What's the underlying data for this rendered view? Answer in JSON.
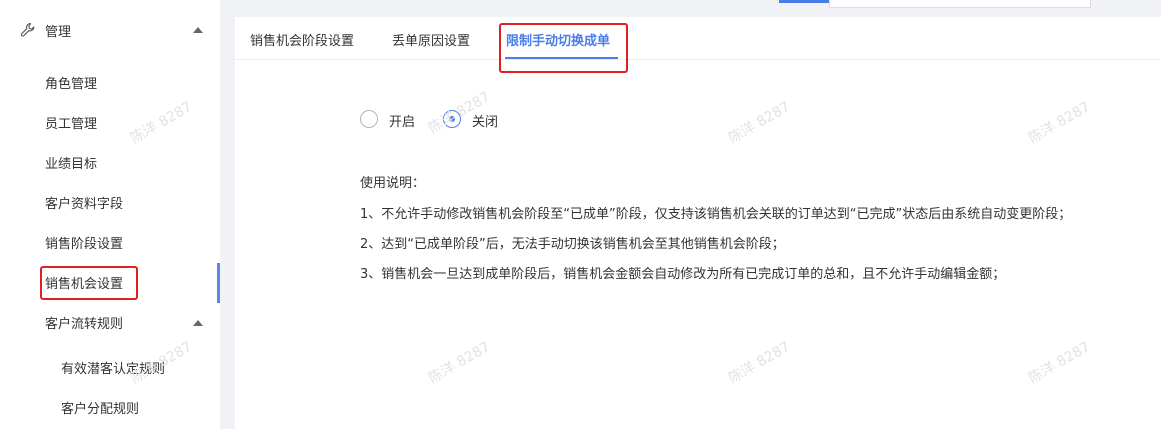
{
  "sidebar": {
    "section": {
      "label": "管理",
      "icon": "wrench-icon",
      "expanded": true
    },
    "items": [
      {
        "label": "角色管理"
      },
      {
        "label": "员工管理"
      },
      {
        "label": "业绩目标"
      },
      {
        "label": "客户资料字段"
      },
      {
        "label": "销售阶段设置"
      },
      {
        "label": "销售机会设置",
        "active": true,
        "highlighted": true
      }
    ],
    "subsection": {
      "label": "客户流转规则",
      "expanded": true,
      "children": [
        {
          "label": "有效潜客认定规则"
        },
        {
          "label": "客户分配规则"
        }
      ]
    }
  },
  "tabs": [
    {
      "label": "销售机会阶段设置"
    },
    {
      "label": "丢单原因设置"
    },
    {
      "label": "限制手动切换成单",
      "active": true,
      "highlighted": true
    }
  ],
  "radio": {
    "options": [
      {
        "label": "开启",
        "checked": false
      },
      {
        "label": "关闭",
        "checked": true
      }
    ]
  },
  "description": {
    "title": "使用说明：",
    "lines": [
      "1、不允许手动修改销售机会阶段至“已成单”阶段，仅支持该销售机会关联的订单达到“已完成”状态后由系统自动变更阶段；",
      "2、达到“已成单阶段”后，无法手动切换该销售机会至其他销售机会阶段；",
      "3、销售机会一旦达到成单阶段后，销售机会金额会自动修改为所有已完成订单的总和，且不允许手动编辑金额；"
    ]
  },
  "watermark": "陈洋 8287",
  "colors": {
    "accent": "#4a7de8",
    "highlight_box": "#e02020",
    "background": "#f0f2f5"
  }
}
